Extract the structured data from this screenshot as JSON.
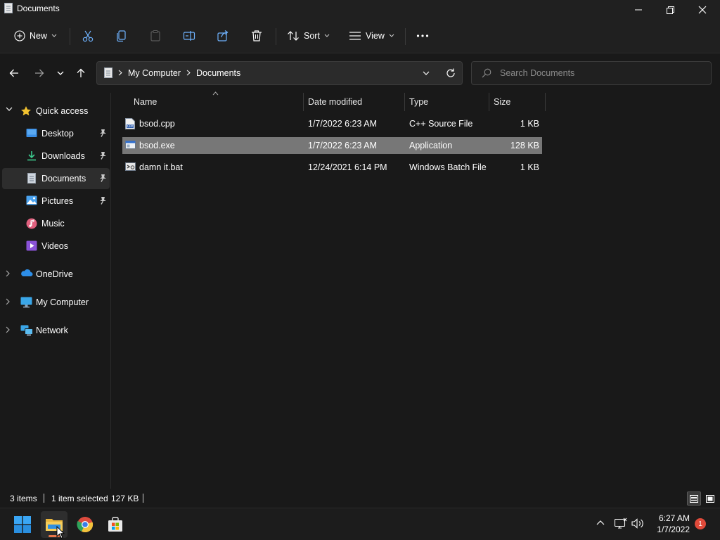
{
  "window": {
    "title": "Documents"
  },
  "toolbar": {
    "new_label": "New",
    "sort_label": "Sort",
    "view_label": "View"
  },
  "address": {
    "crumbs": [
      "My Computer",
      "Documents"
    ],
    "search_placeholder": "Search Documents"
  },
  "sidebar": {
    "items": [
      {
        "label": "Quick access",
        "icon": "star-icon",
        "pinned": false
      },
      {
        "label": "Desktop",
        "icon": "desktop-icon",
        "pinned": true
      },
      {
        "label": "Downloads",
        "icon": "download-icon",
        "pinned": true
      },
      {
        "label": "Documents",
        "icon": "document-icon",
        "pinned": true
      },
      {
        "label": "Pictures",
        "icon": "pictures-icon",
        "pinned": true
      },
      {
        "label": "Music",
        "icon": "music-icon",
        "pinned": false
      },
      {
        "label": "Videos",
        "icon": "videos-icon",
        "pinned": false
      },
      {
        "label": "OneDrive",
        "icon": "cloud-icon",
        "pinned": false
      },
      {
        "label": "My Computer",
        "icon": "computer-icon",
        "pinned": false
      },
      {
        "label": "Network",
        "icon": "network-icon",
        "pinned": false
      }
    ]
  },
  "columns": {
    "name": "Name",
    "date": "Date modified",
    "type": "Type",
    "size": "Size"
  },
  "files": [
    {
      "name": "bsod.cpp",
      "date": "1/7/2022 6:23 AM",
      "type": "C++ Source File",
      "size": "1 KB",
      "icon": "cpp-file-icon"
    },
    {
      "name": "bsod.exe",
      "date": "1/7/2022 6:23 AM",
      "type": "Application",
      "size": "128 KB",
      "icon": "exe-file-icon"
    },
    {
      "name": "damn it.bat",
      "date": "12/24/2021 6:14 PM",
      "type": "Windows Batch File",
      "size": "1 KB",
      "icon": "bat-file-icon"
    }
  ],
  "status": {
    "count": "3 items",
    "selection": "1 item selected",
    "selection_size": "127 KB"
  },
  "clock": {
    "time": "6:27 AM",
    "date": "1/7/2022"
  },
  "notifications": {
    "count": "1"
  },
  "colors": {
    "background": "#191919",
    "selected_row": "#777777",
    "accent_folder": "#f0c14b",
    "notification_badge": "#e04a3a"
  }
}
